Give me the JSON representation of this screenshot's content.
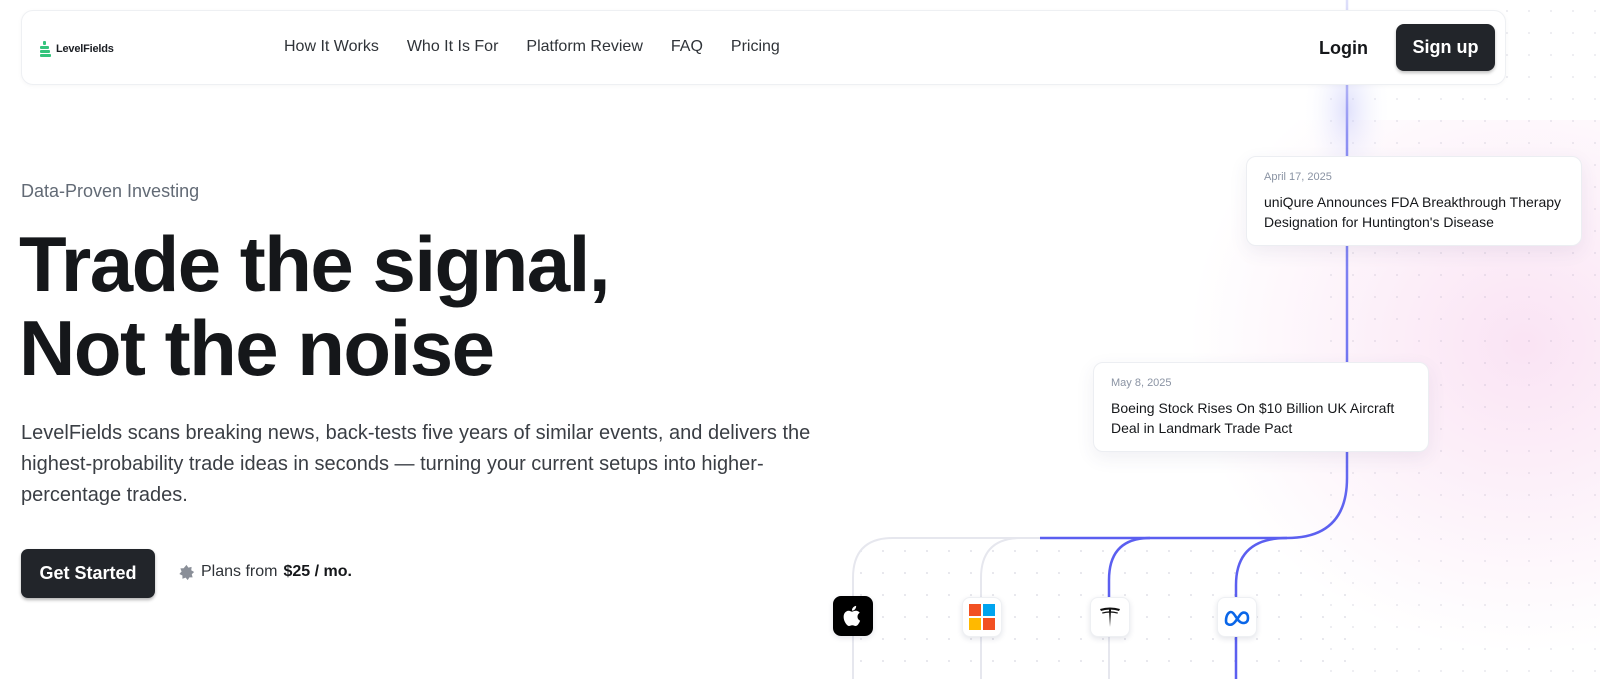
{
  "brand": {
    "name": "LevelFields",
    "accent": "#34c47c"
  },
  "nav": {
    "links": [
      "How It Works",
      "Who It Is For",
      "Platform Review",
      "FAQ",
      "Pricing"
    ],
    "login_label": "Login",
    "signup_label": "Sign up"
  },
  "hero": {
    "eyebrow": "Data-Proven Investing",
    "headline_line1": "Trade the signal,",
    "headline_line2": "Not the noise",
    "lead": "LevelFields scans breaking news, back-tests five years of similar events, and delivers the highest-probability trade ideas in seconds — turning your current setups into higher-percentage trades.",
    "cta_label": "Get Started",
    "plans_prefix": "Plans from",
    "plans_price": "$25 / mo."
  },
  "news_cards": [
    {
      "date": "April 17, 2025",
      "title": "uniQure Announces FDA Breakthrough Therapy Designation for Huntington's Disease"
    },
    {
      "date": "May 8, 2025",
      "title": "Boeing Stock Rises On $10 Billion UK Aircraft Deal in Landmark Trade Pact"
    }
  ],
  "company_tiles": [
    "apple-icon",
    "microsoft-icon",
    "tesla-icon",
    "meta-icon"
  ],
  "colors": {
    "line_accent": "#5b5ff0",
    "button_dark": "#22252a"
  }
}
